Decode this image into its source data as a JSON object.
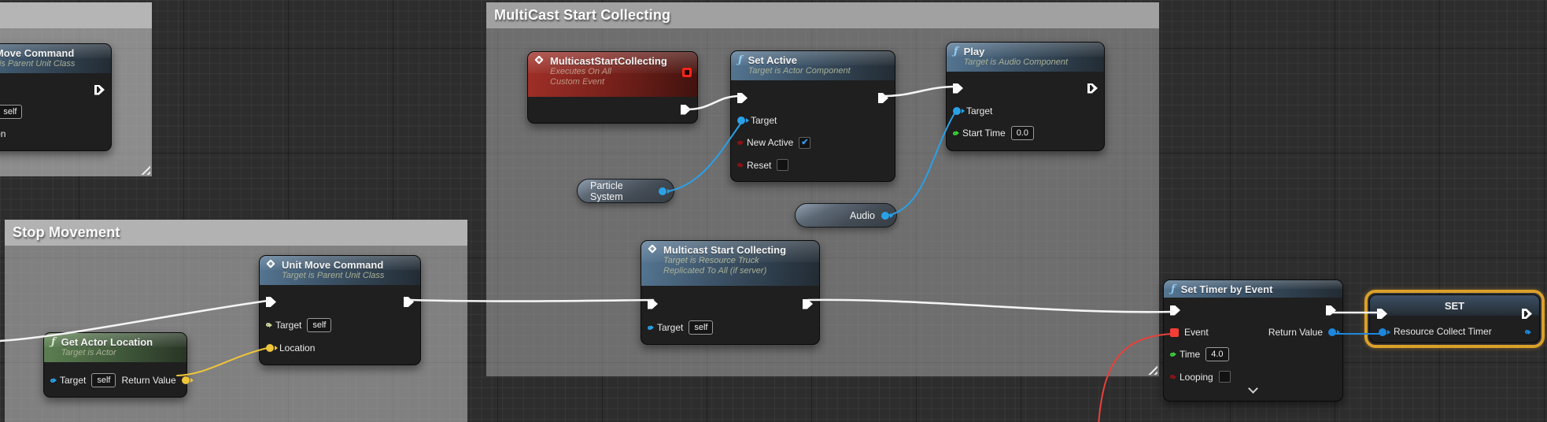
{
  "app": {
    "name": "Blueprint Graph Editor"
  },
  "colors": {
    "background": "#2d2d2d",
    "exec_wire": "#ffffff",
    "object_pin_blue": "#2aa2e8",
    "link_blue": "#1d87dd",
    "bool_pin_red": "#8e1116",
    "float_pin_green": "#39d039",
    "vector_pin_yellow": "#efc53a",
    "delegate_red": "#f53e36",
    "class_pin_olive": "#ccd69c",
    "selection_orange": "#dba02a",
    "event_header_red": "#7c221c",
    "function_header_blue": "#3b5165",
    "pure_header_green": "#46603f"
  },
  "comments": [
    {
      "title": ""
    },
    {
      "title": "Stop Movement"
    },
    {
      "title": "MultiCast Start Collecting"
    }
  ],
  "nodes": {
    "multicast_event": {
      "title": "MulticastStartCollecting",
      "subtitle_line1": "Executes On All",
      "subtitle_line2": "Custom Event"
    },
    "set_active": {
      "title": "Set Active",
      "subtitle": "Target is Actor Component",
      "pins": {
        "target": {
          "label": "Target"
        },
        "new_active": {
          "label": "New Active",
          "checked": true,
          "check_glyph": "✔"
        },
        "reset": {
          "label": "Reset",
          "checked": false
        }
      }
    },
    "play": {
      "title": "Play",
      "subtitle": "Target is Audio Component",
      "pins": {
        "target": {
          "label": "Target"
        },
        "start_time": {
          "label": "Start Time",
          "value": "0.0"
        }
      }
    },
    "multicast_call": {
      "title": "Multicast Start Collecting",
      "subtitle_line1": "Target is Resource Truck",
      "subtitle_line2": "Replicated To All (if server)",
      "pins": {
        "target": {
          "label": "Target",
          "value": "self"
        }
      }
    },
    "unit_move_command": {
      "title": "Unit Move Command",
      "subtitle": "Target is Parent Unit Class",
      "pins": {
        "target": {
          "label": "Target",
          "value": "self"
        },
        "location": {
          "label": "Location"
        }
      }
    },
    "get_actor_location": {
      "title": "Get Actor Location",
      "subtitle": "Target is Actor",
      "pins": {
        "target": {
          "label": "Target",
          "value": "self"
        },
        "return_value": {
          "label": "Return Value"
        }
      }
    },
    "set_timer_by_event": {
      "title": "Set Timer by Event",
      "pins": {
        "event": {
          "label": "Event"
        },
        "return_value": {
          "label": "Return Value"
        },
        "time": {
          "label": "Time",
          "value": "4.0"
        },
        "looping": {
          "label": "Looping",
          "checked": false
        }
      }
    },
    "set_variable": {
      "title": "SET",
      "pins": {
        "variable": {
          "label": "Resource Collect Timer"
        }
      }
    }
  },
  "pills": [
    {
      "label": "Particle System"
    },
    {
      "label": "Audio"
    }
  ]
}
